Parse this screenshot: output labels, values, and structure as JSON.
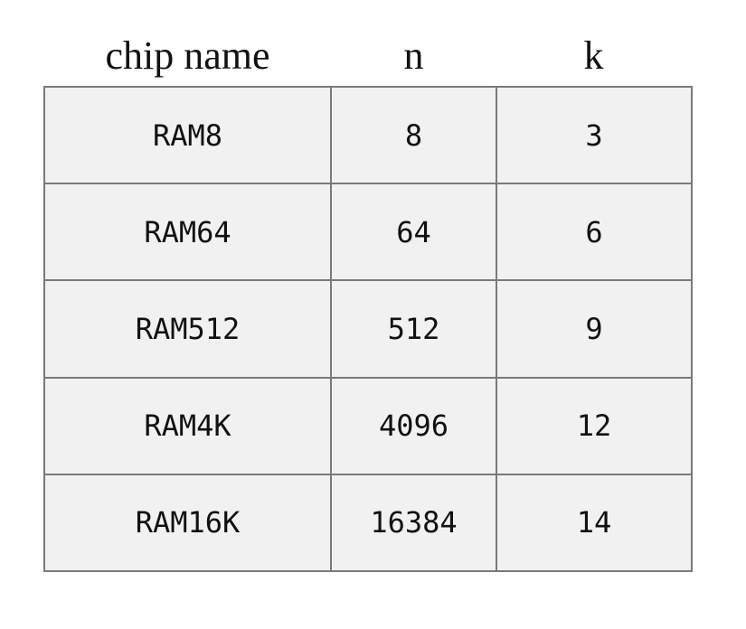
{
  "table": {
    "headers": [
      "chip name",
      "n",
      "k"
    ],
    "rows": [
      [
        "RAM8",
        "8",
        "3"
      ],
      [
        "RAM64",
        "64",
        "6"
      ],
      [
        "RAM512",
        "512",
        "9"
      ],
      [
        "RAM4K",
        "4096",
        "12"
      ],
      [
        "RAM16K",
        "16384",
        "14"
      ]
    ]
  }
}
